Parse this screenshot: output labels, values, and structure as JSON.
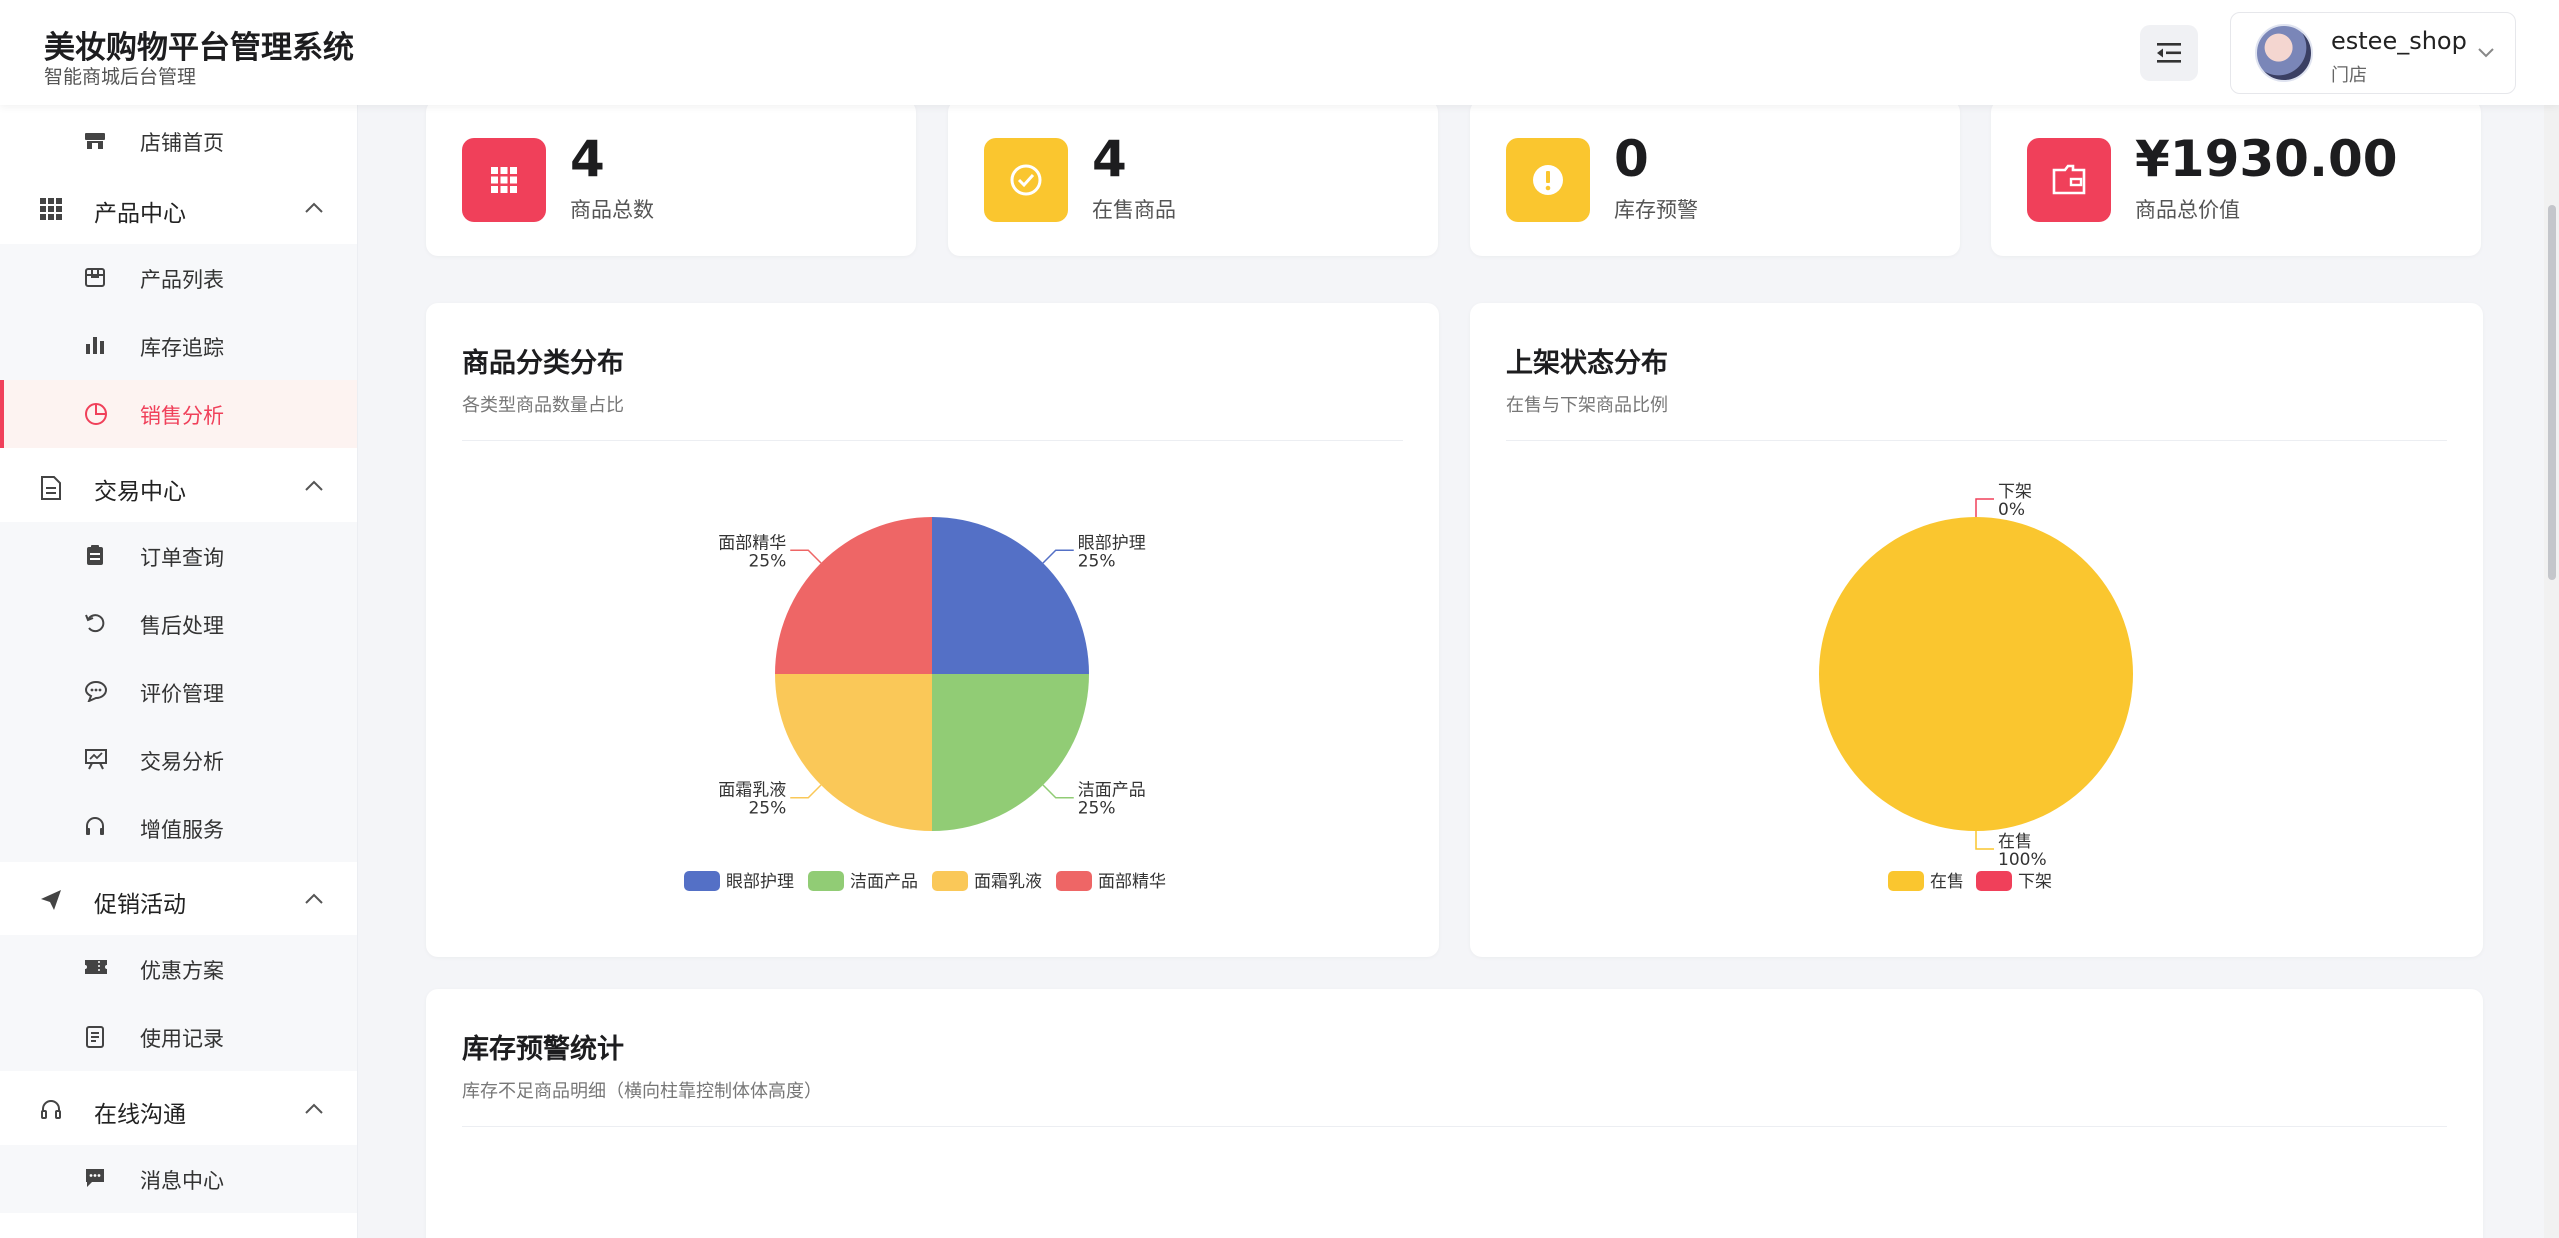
{
  "header": {
    "title": "美妆购物平台管理系统",
    "subtitle": "智能商城后台管理",
    "user": {
      "name": "estee_shop",
      "role": "门店"
    }
  },
  "sidebar": {
    "items": [
      {
        "label": "店铺首页",
        "icon": "store-icon",
        "level": "item",
        "top": 0
      },
      {
        "label": "产品中心",
        "icon": "grid-icon",
        "level": "group"
      },
      {
        "label": "产品列表",
        "icon": "box-icon",
        "level": "item"
      },
      {
        "label": "库存追踪",
        "icon": "bar-chart-icon",
        "level": "item"
      },
      {
        "label": "销售分析",
        "icon": "pie-icon",
        "level": "item",
        "active": true
      },
      {
        "label": "交易中心",
        "icon": "document-icon",
        "level": "group"
      },
      {
        "label": "订单查询",
        "icon": "clipboard-icon",
        "level": "item"
      },
      {
        "label": "售后处理",
        "icon": "refresh-icon",
        "level": "item"
      },
      {
        "label": "评价管理",
        "icon": "chat-icon",
        "level": "item"
      },
      {
        "label": "交易分析",
        "icon": "presentation-icon",
        "level": "item"
      },
      {
        "label": "增值服务",
        "icon": "headset-icon",
        "level": "item"
      },
      {
        "label": "促销活动",
        "icon": "send-icon",
        "level": "group"
      },
      {
        "label": "优惠方案",
        "icon": "ticket-icon",
        "level": "item"
      },
      {
        "label": "使用记录",
        "icon": "record-icon",
        "level": "item"
      },
      {
        "label": "在线沟通",
        "icon": "headset-icon",
        "level": "group"
      },
      {
        "label": "消息中心",
        "icon": "message-icon",
        "level": "item"
      }
    ]
  },
  "stats": [
    {
      "value": "4",
      "label": "商品总数",
      "color": "#f0405a",
      "icon": "grid-icon"
    },
    {
      "value": "4",
      "label": "在售商品",
      "color": "#fac62f",
      "icon": "check-circle-icon"
    },
    {
      "value": "0",
      "label": "库存预警",
      "color": "#fac62f",
      "icon": "alert-icon"
    },
    {
      "value": "¥1930.00",
      "label": "商品总价值",
      "color": "#f0405a",
      "icon": "wallet-icon"
    }
  ],
  "panels": {
    "category": {
      "title": "商品分类分布",
      "subtitle": "各类型商品数量占比"
    },
    "status": {
      "title": "上架状态分布",
      "subtitle": "在售与下架商品比例"
    },
    "stock": {
      "title": "库存预警统计",
      "subtitle": "库存不足商品明细（横向柱靠控制体体高度）"
    }
  },
  "chart_data": [
    {
      "type": "pie",
      "title": "商品分类分布",
      "categories": [
        "眼部护理",
        "洁面产品",
        "面霜乳液",
        "面部精华"
      ],
      "values": [
        1,
        1,
        1,
        1
      ],
      "percent_labels": [
        "25%",
        "25%",
        "25%",
        "25%"
      ],
      "colors": [
        "#5470c6",
        "#91cc75",
        "#fac858",
        "#ee6666"
      ],
      "legend": "bottom"
    },
    {
      "type": "pie",
      "title": "上架状态分布",
      "categories": [
        "在售",
        "下架"
      ],
      "values": [
        4,
        0
      ],
      "percent_labels": [
        "100%",
        "0%"
      ],
      "colors": [
        "#fac62f",
        "#f0405a"
      ],
      "legend": "bottom"
    }
  ]
}
